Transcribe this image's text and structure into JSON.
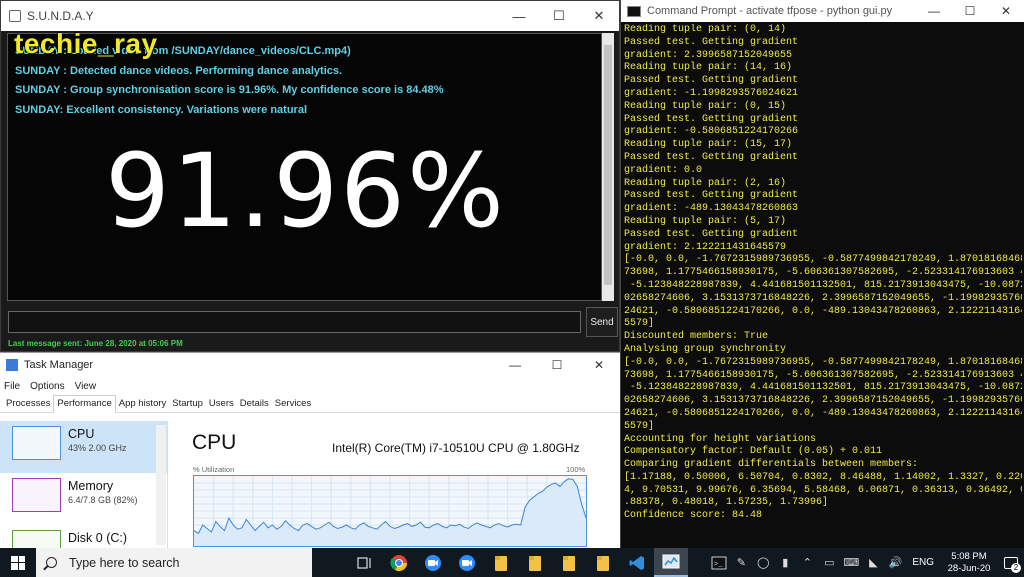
{
  "watermark": "techie_ray",
  "sunday": {
    "title": "S.U.N.D.A.Y",
    "lines": [
      "SUNDAY : Loaded video from /SUNDAY/dance_videos/CLC.mp4)",
      "SUNDAY : Detected dance videos. Performing dance analytics.",
      "SUNDAY : Group synchronisation score is 91.96%. My confidence score is 84.48%",
      "SUNDAY: Excellent consistency. Variations were natural"
    ],
    "score_display": "91.96%",
    "message_input_value": "",
    "send_label": "Send",
    "last_message": "Last message sent: June 28, 2020 at 05:06 PM"
  },
  "cmd": {
    "title": "Command Prompt - activate  tfpose - python  gui.py",
    "lines": [
      "Reading tuple pair: (0, 14)",
      "Passed test. Getting gradient",
      "gradient: 2.3996587152049655",
      "Reading tuple pair: (14, 16)",
      "Passed test. Getting gradient",
      "gradient: -1.1998293576024621",
      "Reading tuple pair: (0, 15)",
      "Passed test. Getting gradient",
      "gradient: -0.5806851224170266",
      "Reading tuple pair: (15, 17)",
      "Passed test. Getting gradient",
      "gradient: 0.0",
      "Reading tuple pair: (2, 16)",
      "Passed test. Getting gradient",
      "gradient: -489.13043478260863",
      "Reading tuple pair: (5, 17)",
      "Passed test. Getting gradient",
      "gradient: 2.122211431645579",
      "[-0.0, 0.0, -1.7672315989736955, -0.5877499842178249, 1.87018168468",
      "73698, 1.1775466158930175, -5.606361307582695, -2.523314176913603 4,",
      " -5.123848228987839, 4.441681501132501, 815.2173913043475, -10.0872",
      "02658274606, 3.1531373716848226, 2.3996587152049655, -1.19982935760",
      "24621, -0.5806851224170266, 0.0, -489.13043478260863, 2.12221143164",
      "5579]",
      "Discounted members: True",
      "Analysing group synchronity",
      "[-0.0, 0.0, -1.7672315989736955, -0.5877499842178249, 1.87018168468",
      "73698, 1.1775466158930175, -5.606361307582695, -2.523314176913603 4,",
      " -5.123848228987839, 4.441681501132501, 815.2173913043475, -10.0872",
      "02658274606, 3.1531373716848226, 2.3996587152049655, -1.19982935760",
      "24621, -0.5806851224170266, 0.0, -489.13043478260863, 2.12221143164",
      "5579]",
      "Accounting for height variations",
      "Compensatory factor: Default (0.05) + 0.011",
      "Comparing gradient differentials between members:",
      "[1.17188, 0.50006, 6.50704, 0.8302, 8.46488, 1.14002, 1.3327, 0.220",
      "4, 9.70531, 9.99676, 6.35694, 5.58468, 6.06871, 0.36313, 0.36492, 0",
      ".88378, 0.48018, 1.57235, 1.73996]",
      "Confidence score: 84.48"
    ]
  },
  "taskmanager": {
    "title": "Task Manager",
    "menu": [
      "File",
      "Options",
      "View"
    ],
    "tabs": [
      "Processes",
      "Performance",
      "App history",
      "Startup",
      "Users",
      "Details",
      "Services"
    ],
    "active_tab": "Performance",
    "resources": [
      {
        "name": "CPU",
        "value": "43% 2.00 GHz"
      },
      {
        "name": "Memory",
        "value": "6.4/7.8 GB (82%)"
      },
      {
        "name": "Disk 0 (C:)",
        "value": ""
      }
    ],
    "main_title": "CPU",
    "cpu_model": "Intel(R) Core(TM) i7-10510U CPU @ 1.80GHz",
    "util_label": "% Utilization",
    "util_max": "100%",
    "graph_values": [
      22,
      18,
      30,
      25,
      20,
      35,
      28,
      22,
      40,
      30,
      24,
      26,
      38,
      30,
      22,
      28,
      34,
      26,
      30,
      24,
      28,
      36,
      30,
      25,
      22,
      30,
      32,
      28,
      24,
      26,
      30,
      34,
      28,
      25,
      27,
      30,
      26,
      24,
      30,
      33,
      28,
      26,
      24,
      30,
      35,
      28,
      25,
      27,
      30,
      32,
      28,
      30,
      34,
      27,
      26,
      30,
      32,
      28,
      26,
      30,
      29,
      31,
      27,
      25,
      30,
      33,
      30,
      28,
      26,
      30,
      32,
      29,
      27,
      30,
      31,
      30,
      55,
      65,
      70,
      75,
      78,
      84,
      88,
      90,
      85,
      92,
      96,
      95,
      85,
      60,
      40
    ]
  },
  "taskbar": {
    "search_placeholder": "Type here to search",
    "language": "ENG",
    "time": "5:08 PM",
    "date": "28-Jun-20",
    "notification_count": "2",
    "icon_colors": {
      "chrome": "#e8b33a",
      "zoom": "#2d8cff",
      "folder": "#f2c247",
      "vscode": "#2f8fdc",
      "accent": "#9bbbe0"
    }
  }
}
